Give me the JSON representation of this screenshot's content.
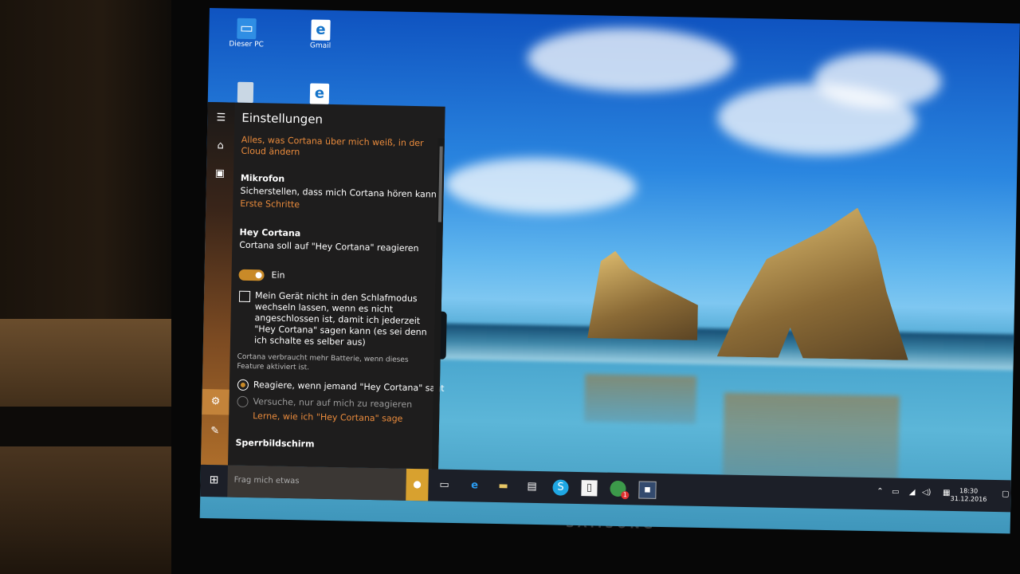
{
  "desktop": {
    "icons": [
      {
        "label": "Dieser PC"
      },
      {
        "label": "Gmail"
      }
    ]
  },
  "cortana": {
    "title": "Einstellungen",
    "cloud_link": "Alles, was Cortana über mich weiß, in der Cloud ändern",
    "mikrofon": {
      "heading": "Mikrofon",
      "text": "Sicherstellen, dass mich Cortana hören kann.",
      "link": "Erste Schritte"
    },
    "hey_cortana": {
      "heading": "Hey Cortana",
      "text": "Cortana soll auf \"Hey Cortana\" reagieren",
      "toggle_state": "Ein",
      "checkbox_label": "Mein Gerät nicht in den Schlafmodus wechseln lassen, wenn es nicht angeschlossen ist, damit ich jederzeit \"Hey Cortana\" sagen kann (es sei denn ich schalte es selber aus)",
      "battery_note": "Cortana verbraucht mehr Batterie, wenn dieses Feature aktiviert ist.",
      "radio_1": "Reagiere, wenn jemand \"Hey Cortana\" sagt",
      "radio_2": "Versuche, nur auf mich zu reagieren",
      "learn_link": "Lerne, wie ich \"Hey Cortana\" sage"
    },
    "lockscreen_heading": "Sperrbildschirm"
  },
  "taskbar": {
    "search_placeholder": "Frag mich etwas",
    "clock_time": "18:30",
    "clock_date": "31.12.2016",
    "notification_badge": "1"
  },
  "brand": "SAMSUNG",
  "colors": {
    "accent": "#c98a28",
    "link": "#e88a3c",
    "panel_bg": "#1e1d1d",
    "taskbar_bg": "#1c1f28"
  }
}
